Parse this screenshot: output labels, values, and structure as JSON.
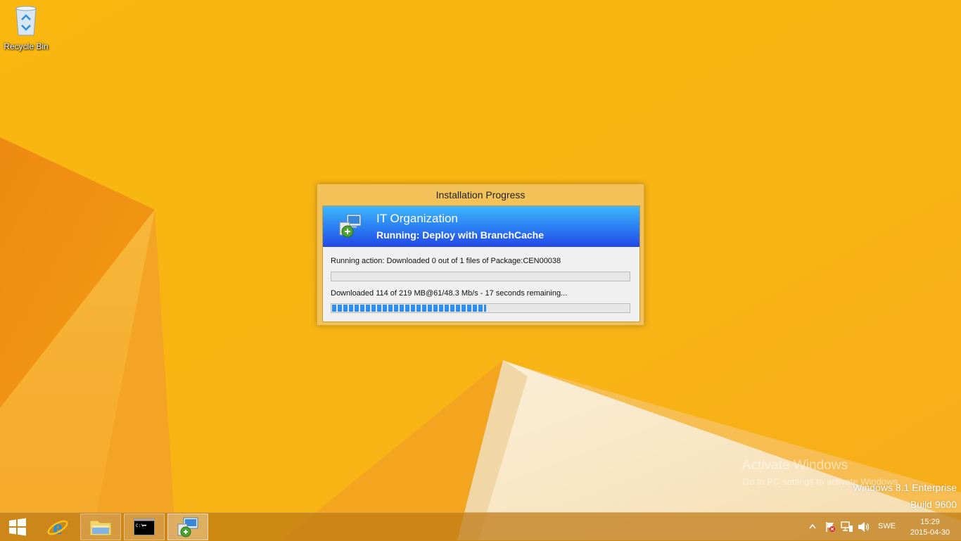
{
  "desktop": {
    "icons": [
      {
        "label": "Recycle Bin",
        "icon": "recycle-bin-icon"
      }
    ]
  },
  "dialog": {
    "title": "Installation Progress",
    "organization": "IT Organization",
    "running_title": "Running: Deploy with BranchCache",
    "action_status": "Running action: Downloaded 0 out of 1 files of Package:CEN00038",
    "action_progress": 0,
    "download_status": "Downloaded 114 of 219 MB@61/48.3 Mb/s - 17 seconds remaining...",
    "download_progress": 0.52
  },
  "watermark": {
    "title": "Activate Windows",
    "subtitle": "Go to PC settings to activate Windows."
  },
  "edition": {
    "name": "Windows 8.1 Enterprise",
    "build": "Build 9600"
  },
  "taskbar": {
    "items": [
      {
        "name": "start-button",
        "icon": "windows-logo-icon"
      },
      {
        "name": "internet-explorer",
        "icon": "ie-icon"
      },
      {
        "name": "file-explorer",
        "icon": "folder-icon"
      },
      {
        "name": "command-prompt",
        "icon": "cmd-icon"
      },
      {
        "name": "software-center",
        "icon": "installer-icon"
      }
    ],
    "tray": {
      "icons": [
        "show-hidden-icons-chevron",
        "action-center-flag-icon",
        "network-icon",
        "volume-icon"
      ],
      "language": "SWE",
      "time": "15:29",
      "date": "2015-04-30"
    }
  },
  "colors": {
    "accent_blue": "#2a7cf3",
    "progress_blue": "#2f8ff0",
    "wallpaper": "#f8b511"
  }
}
